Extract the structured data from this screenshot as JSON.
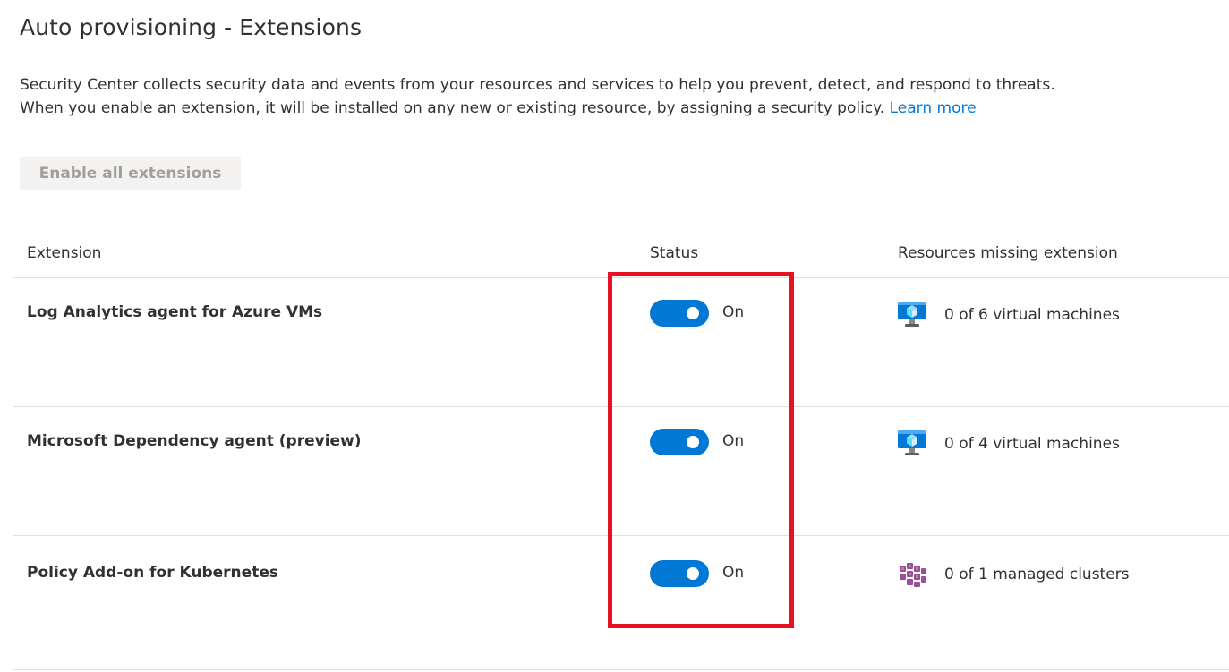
{
  "page": {
    "title": "Auto provisioning - Extensions",
    "description_line1": "Security Center collects security data and events from your resources and services to help you prevent, detect, and respond to threats.",
    "description_line2": "When you enable an extension, it will be installed on any new or existing resource, by assigning a security policy.",
    "learn_more": "Learn more",
    "enable_all_label": "Enable all extensions"
  },
  "table": {
    "columns": [
      "Extension",
      "Status",
      "Resources missing extension"
    ],
    "rows": [
      {
        "name": "Log Analytics agent for Azure VMs",
        "status": "On",
        "enabled": true,
        "resource_icon": "virtual-machine-icon",
        "resources_missing": "0 of 6 virtual machines"
      },
      {
        "name": "Microsoft Dependency agent (preview)",
        "status": "On",
        "enabled": true,
        "resource_icon": "virtual-machine-icon",
        "resources_missing": "0 of 4 virtual machines"
      },
      {
        "name": "Policy Add-on for Kubernetes",
        "status": "On",
        "enabled": true,
        "resource_icon": "kubernetes-cluster-icon",
        "resources_missing": "0 of 1 managed clusters"
      }
    ]
  },
  "colors": {
    "accent": "#0078d4",
    "highlight": "#e81123",
    "text": "#323130",
    "disabled_text": "#a19f9d",
    "divider": "#e1dfdd"
  }
}
